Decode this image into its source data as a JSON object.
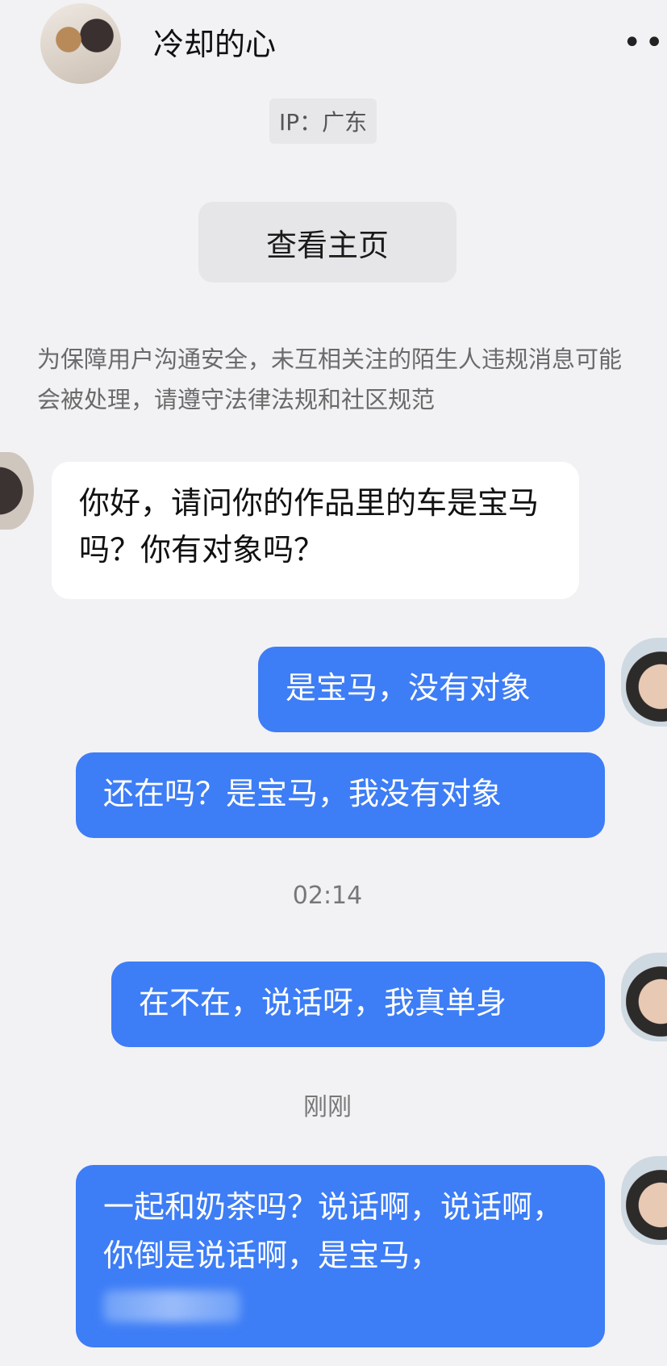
{
  "header": {
    "contact_name": "冷却的心",
    "more_icon": "more-dots-icon"
  },
  "ip_label": "IP：广东",
  "view_homepage_label": "查看主页",
  "notice": "为保障用户沟通安全，未互相关注的陌生人违规消息可能会被处理，请遵守法律法规和社区规范",
  "messages": [
    {
      "from": "them",
      "text": "你好，请问你的作品里的车是宝马吗？你有对象吗？"
    },
    {
      "from": "me",
      "text": "是宝马，没有对象"
    },
    {
      "from": "me",
      "text": "还在吗？是宝马，我没有对象"
    },
    {
      "from": "me",
      "text": "在不在，说话呀，我真单身"
    },
    {
      "from": "me",
      "text": "一起和奶茶吗？说话啊，说话啊，你倒是说话啊，是宝马，"
    }
  ],
  "timestamps": [
    "02:14",
    "刚刚"
  ],
  "colors": {
    "background": "#f2f2f4",
    "outgoing_bubble": "#3d7df6",
    "incoming_bubble": "#ffffff"
  }
}
